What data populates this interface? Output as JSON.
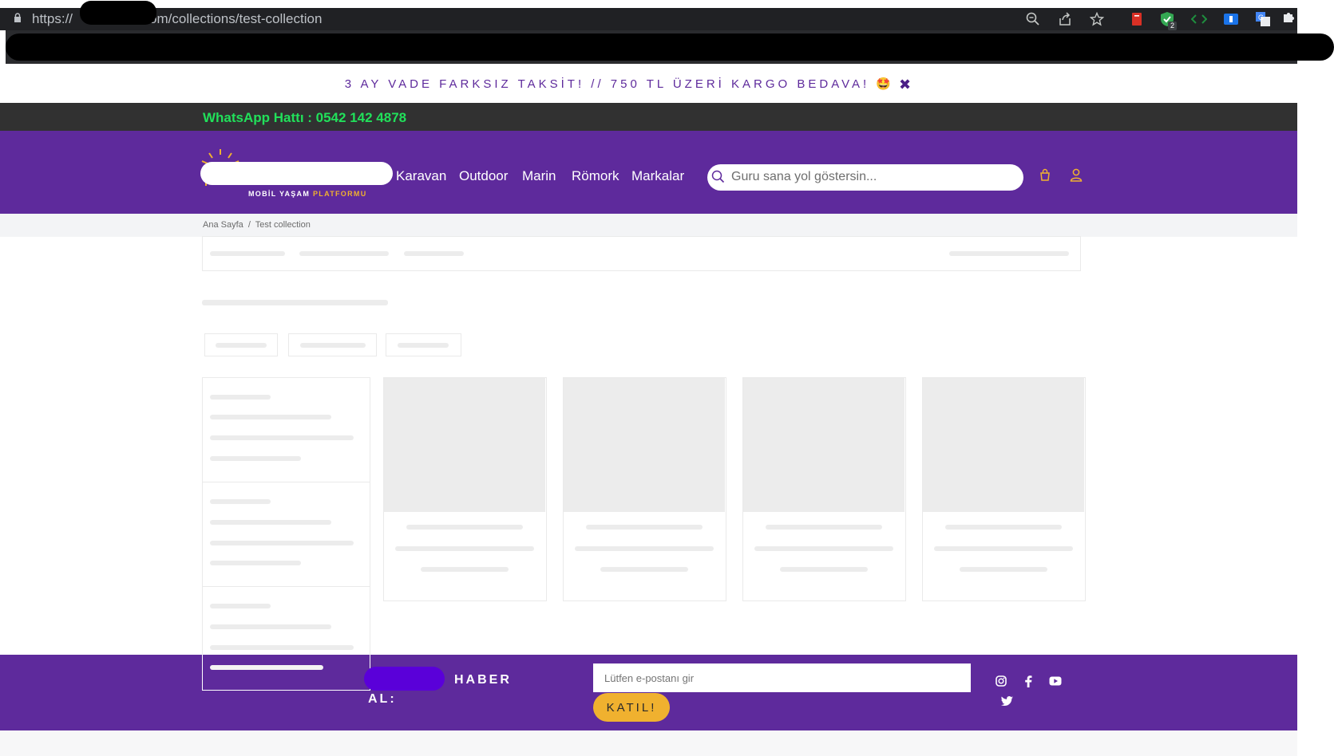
{
  "browser": {
    "url_prefix": "https://",
    "url_suffix": "om/collections/test-collection",
    "extension_badge": "2"
  },
  "announcement": {
    "text": "3 AY VADE FARKSIZ TAKSİT! // 750 TL ÜZERİ KARGO BEDAVA! 🤩",
    "close_label": "✖"
  },
  "topbar": {
    "whatsapp": "WhatsApp Hattı : 0542 142 4878"
  },
  "header": {
    "logo_tagline_a": "MOBİL YAŞAM",
    "logo_tagline_b": "PLATFORMU",
    "nav": [
      "Karavan",
      "Outdoor",
      "Marin",
      "Römork",
      "Markalar"
    ],
    "search_placeholder": "Guru sana yol göstersin..."
  },
  "breadcrumb": {
    "home": "Ana Sayfa",
    "separator": "/",
    "current": "Test collection"
  },
  "footer": {
    "newsletter_title_a": "HABER",
    "newsletter_title_b": "AL:",
    "email_placeholder": "Lütfen e-postanı gir",
    "join_label": "KATIL!"
  },
  "colors": {
    "brand_purple": "#5e2a9c",
    "accent_orange": "#f0b12f",
    "whatsapp_green": "#21e05a",
    "topbar_dark": "#313131"
  }
}
